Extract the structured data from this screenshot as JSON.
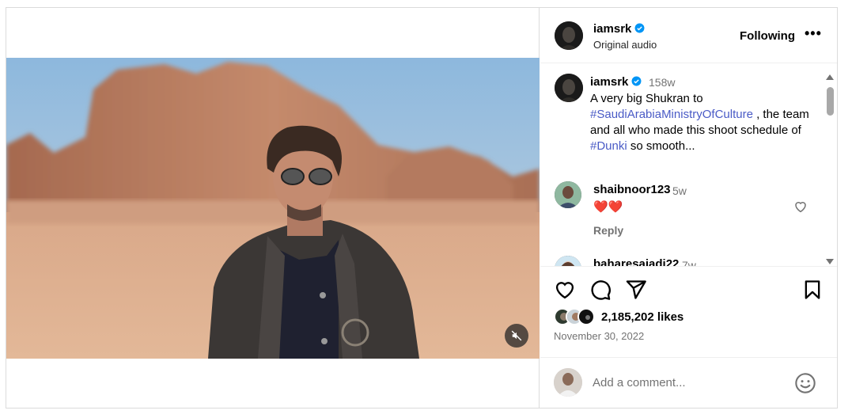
{
  "post": {
    "author": "iamsrk",
    "audio": "Original audio",
    "follow_state": "Following",
    "more_label": "•••",
    "time_ago": "158w",
    "caption_parts": [
      {
        "text": "A very big Shukran to ",
        "type": "text"
      },
      {
        "text": "#SaudiArabiaMinistryOfCulture",
        "type": "hashtag"
      },
      {
        "text": " , the team and all who made this shoot schedule of ",
        "type": "text"
      },
      {
        "text": "#Dunki",
        "type": "hashtag"
      },
      {
        "text": " so smooth...",
        "type": "text"
      }
    ],
    "likes": "2,185,202 likes",
    "date": "November 30, 2022"
  },
  "comments": [
    {
      "user": "shaibnoor123",
      "time": "5w",
      "text": "❤️❤️",
      "reply": "Reply"
    },
    {
      "user": "baharesajadi22",
      "time": "7w",
      "text": "",
      "reply": ""
    }
  ],
  "composer": {
    "placeholder": "Add a comment..."
  },
  "icons": {
    "mute": "speaker-muted-icon",
    "like": "heart-outline-icon",
    "comment": "speech-bubble-icon",
    "share": "paper-plane-icon",
    "save": "bookmark-icon",
    "emoji": "smiley-icon",
    "verified": "verified-badge-icon"
  },
  "colors": {
    "verified": "#0095f6",
    "hashtag": "#4a5bc6",
    "secondary_text": "#737373"
  }
}
